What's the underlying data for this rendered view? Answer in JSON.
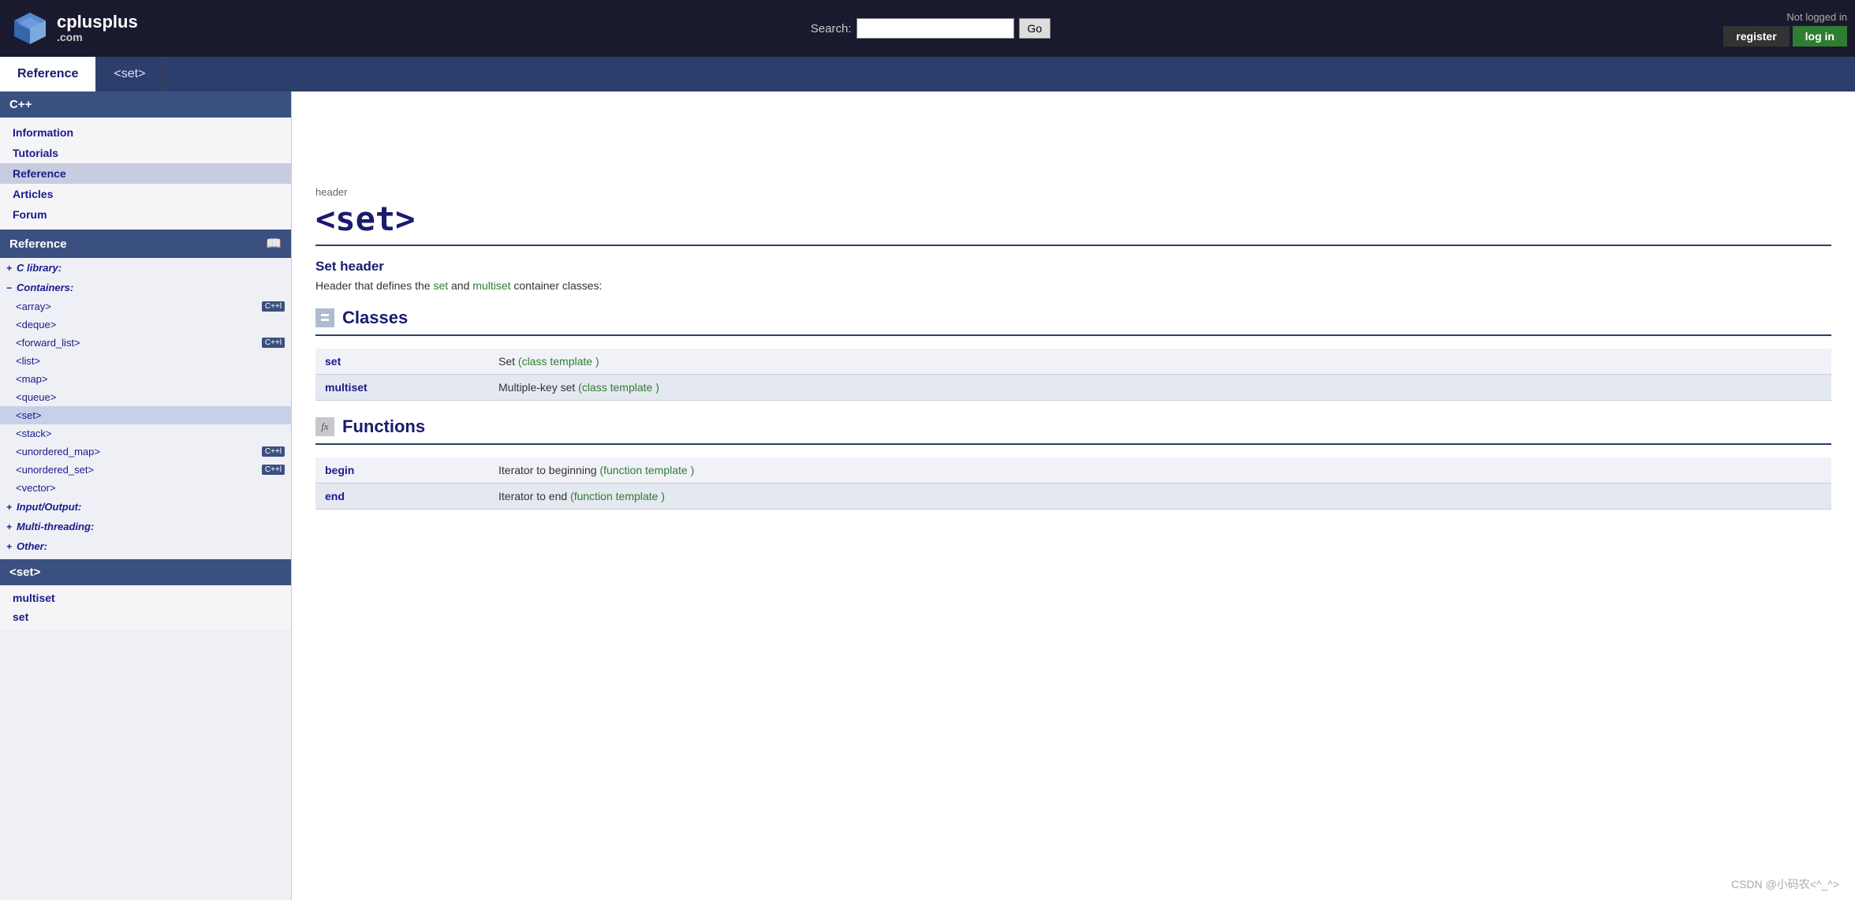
{
  "header": {
    "logo_text": "cplusplus",
    "logo_domain": ".com",
    "search_label": "Search:",
    "search_placeholder": "",
    "go_button": "Go",
    "not_logged_in": "Not logged in",
    "register_label": "register",
    "login_label": "log in"
  },
  "navbar": {
    "items": [
      {
        "label": "Reference",
        "id": "nav-reference",
        "active": true
      },
      {
        "label": "<set>",
        "id": "nav-set",
        "active": false
      }
    ]
  },
  "sidebar": {
    "cpp_section": {
      "title": "C++",
      "items": [
        {
          "label": "Information",
          "active": false
        },
        {
          "label": "Tutorials",
          "active": false
        },
        {
          "label": "Reference",
          "active": true
        },
        {
          "label": "Articles",
          "active": false
        },
        {
          "label": "Forum",
          "active": false
        }
      ]
    },
    "reference_section": {
      "title": "Reference",
      "categories": [
        {
          "label": "C library:",
          "collapsed": true,
          "icon": "+"
        },
        {
          "label": "Containers:",
          "collapsed": false,
          "icon": "-",
          "items": [
            {
              "label": "<array>",
              "badge": "C++11"
            },
            {
              "label": "<deque>",
              "badge": null
            },
            {
              "label": "<forward_list>",
              "badge": "C++11"
            },
            {
              "label": "<list>",
              "badge": null
            },
            {
              "label": "<map>",
              "badge": null
            },
            {
              "label": "<queue>",
              "badge": null
            },
            {
              "label": "<set>",
              "badge": null,
              "active": true
            },
            {
              "label": "<stack>",
              "badge": null
            },
            {
              "label": "<unordered_map>",
              "badge": "C++11"
            },
            {
              "label": "<unordered_set>",
              "badge": "C++11"
            },
            {
              "label": "<vector>",
              "badge": null
            }
          ]
        },
        {
          "label": "Input/Output:",
          "collapsed": true,
          "icon": "+"
        },
        {
          "label": "Multi-threading:",
          "collapsed": true,
          "icon": "+"
        },
        {
          "label": "Other:",
          "collapsed": true,
          "icon": "+"
        }
      ]
    },
    "set_section": {
      "title": "<set>",
      "items": [
        {
          "label": "multiset"
        },
        {
          "label": "set"
        }
      ]
    }
  },
  "content": {
    "header_label": "header",
    "page_title": "<set>",
    "section_title": "Set header",
    "section_desc_prefix": "Header that defines the ",
    "section_desc_link1": "set",
    "section_desc_middle": " and ",
    "section_desc_link2": "multiset",
    "section_desc_suffix": " container classes:",
    "classes_section": {
      "title": "Classes",
      "rows": [
        {
          "name": "set",
          "desc": "Set ",
          "template_label": "(class template )"
        },
        {
          "name": "multiset",
          "desc": "Multiple-key set ",
          "template_label": "(class template )"
        }
      ]
    },
    "functions_section": {
      "title": "Functions",
      "rows": [
        {
          "name": "begin",
          "desc": "Iterator to beginning ",
          "template_label": "(function template )"
        },
        {
          "name": "end",
          "desc": "Iterator to end ",
          "template_label": "(function template )"
        }
      ]
    }
  },
  "watermark": "CSDN @小码农<^_^>"
}
